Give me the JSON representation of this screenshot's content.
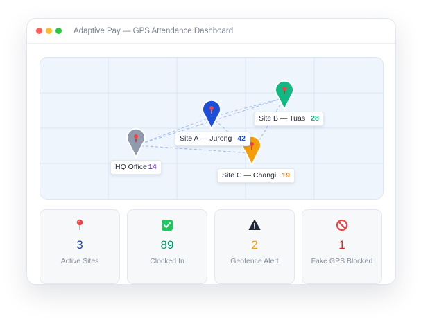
{
  "window": {
    "title": "Adaptive Pay — GPS Attendance Dashboard",
    "controls": [
      "close",
      "minimize",
      "maximize"
    ],
    "control_colors": [
      "#ff5f57",
      "#febc2e",
      "#28c840"
    ]
  },
  "map": {
    "sites": [
      {
        "id": "hq",
        "name": "HQ Office",
        "count": "14",
        "pin_color": "#8f9aac",
        "count_color": "#7c3aed"
      },
      {
        "id": "jurong",
        "name": "Site A — Jurong",
        "count": "42",
        "pin_color": "#1d4ed8",
        "count_color": "#1d4ed8"
      },
      {
        "id": "tuas",
        "name": "Site B — Tuas",
        "count": "28",
        "pin_color": "#10b981",
        "count_color": "#10b981"
      },
      {
        "id": "changi",
        "name": "Site C — Changi",
        "count": "19",
        "pin_color": "#f59e0b",
        "count_color": "#d97706"
      }
    ]
  },
  "stats": [
    {
      "icon": "pin-icon",
      "value": "3",
      "label": "Active Sites",
      "color": "#1e40af"
    },
    {
      "icon": "check-box-icon",
      "value": "89",
      "label": "Clocked In",
      "color": "#059669"
    },
    {
      "icon": "warning-icon",
      "value": "2",
      "label": "Geofence Alert",
      "color": "#f59e0b"
    },
    {
      "icon": "blocked-icon",
      "value": "1",
      "label": "Fake GPS Blocked",
      "color": "#dc2626"
    }
  ]
}
